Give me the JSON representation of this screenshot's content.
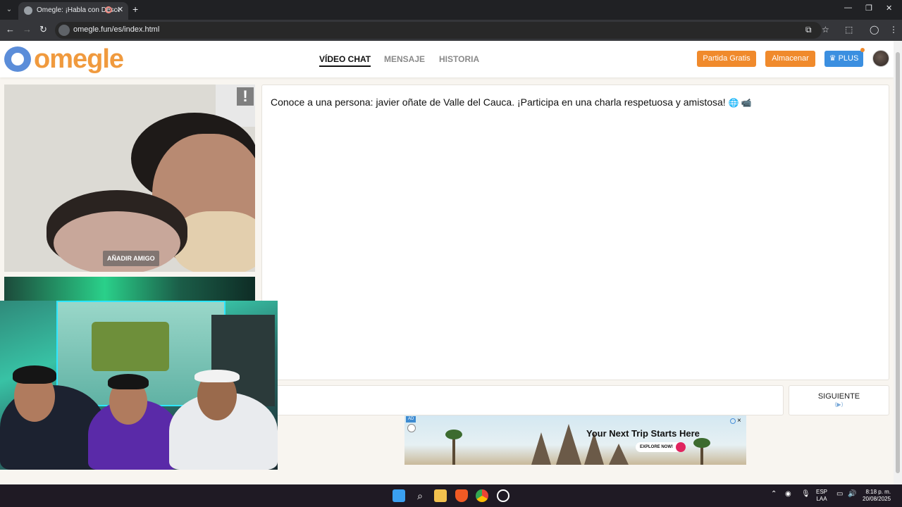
{
  "browser": {
    "tab_title": "Omegle: ¡Habla con Desconocidos!",
    "url": "omegle.fun/es/index.html"
  },
  "header": {
    "logo_text": "omegle",
    "nav": [
      {
        "label": "VÍDEO CHAT",
        "active": true
      },
      {
        "label": "MENSAJE",
        "active": false
      },
      {
        "label": "HISTORIA",
        "active": false
      }
    ],
    "buttons": {
      "free_match": "Partida Gratis",
      "store": "Almacenar",
      "plus": "PLUS"
    },
    "colors": {
      "orange": "#f08a2c",
      "blue": "#3b8fe0",
      "logo_blue": "#5b8dd9",
      "logo_orange": "#f09a3e"
    }
  },
  "video": {
    "report_label": "!",
    "add_friend_label": "AÑADIR AMIGO"
  },
  "chat": {
    "message": "Conoce a una persona: javier oñate de Valle del Cauca. ¡Participa en una charla respetuosa y amistosa!",
    "emojis": "🌐 📹"
  },
  "controls": {
    "next_label": "SIGUIENTE",
    "next_hint": "⟨▶⟩"
  },
  "ad": {
    "tag": "AD",
    "title": "Your Next Trip Starts Here",
    "cta": "EXPLORE NOW!",
    "close": "×"
  },
  "taskbar": {
    "lang_top": "ESP",
    "lang_bottom": "LAA",
    "time": "8:18 p. m.",
    "date": "20/08/2025"
  }
}
